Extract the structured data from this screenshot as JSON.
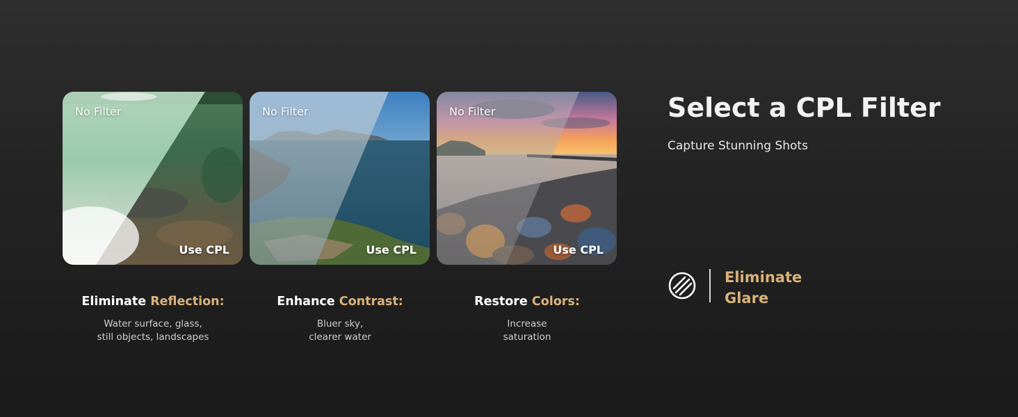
{
  "accent_color": "#d9b27a",
  "title": "Select a CPL Filter",
  "subtitle": "Capture Stunning Shots",
  "cards": [
    {
      "before_label": "No Filter",
      "after_label": "Use CPL",
      "caption_lead": "Eliminate",
      "caption_accent": "Reflection:",
      "desc_line1": "Water surface, glass,",
      "desc_line2": "still objects, landscapes"
    },
    {
      "before_label": "No Filter",
      "after_label": "Use CPL",
      "caption_lead": "Enhance",
      "caption_accent": "Contrast:",
      "desc_line1": "Bluer sky,",
      "desc_line2": "clearer water"
    },
    {
      "before_label": "No Filter",
      "after_label": "Use CPL",
      "caption_lead": "Restore",
      "caption_accent": "Colors:",
      "desc_line1": "Increase",
      "desc_line2": "saturation"
    }
  ],
  "feature": {
    "icon": "glare-filter-icon",
    "line1": "Eliminate",
    "line2": "Glare"
  }
}
